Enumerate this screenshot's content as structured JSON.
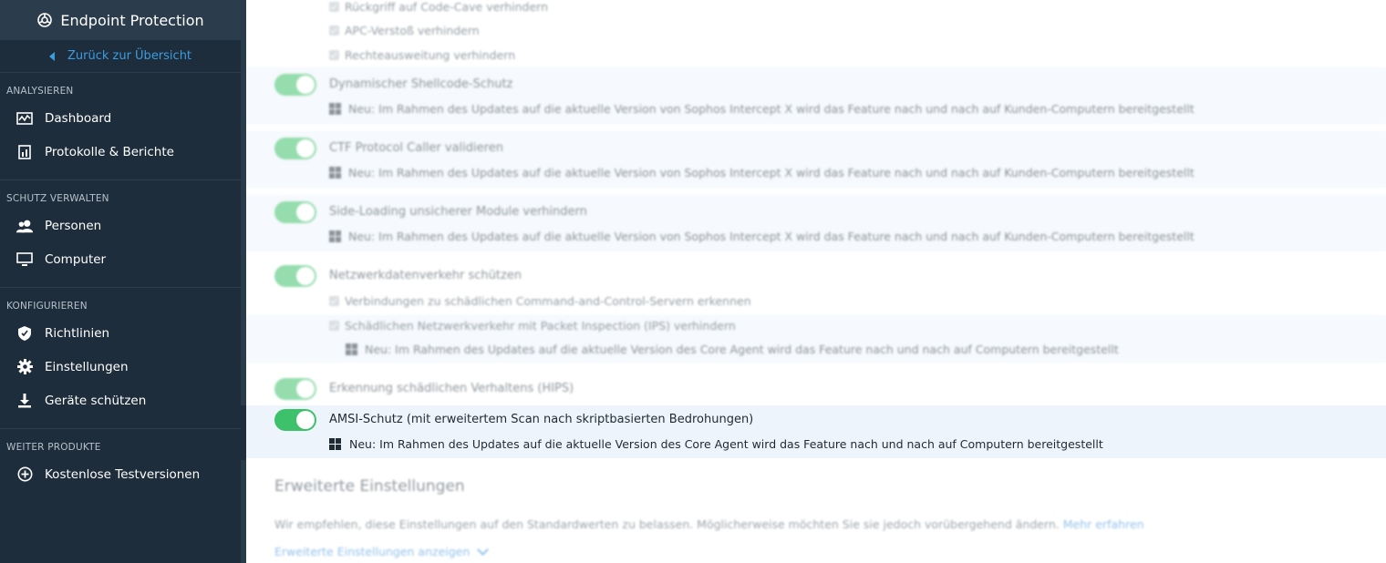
{
  "sidebar": {
    "product_name": "Endpoint Protection",
    "back_label": "Zurück zur Übersicht",
    "sections": [
      {
        "title": "ANALYSIEREN",
        "items": [
          {
            "label": "Dashboard",
            "icon": "dashboard-icon"
          },
          {
            "label": "Protokolle & Berichte",
            "icon": "reports-icon"
          }
        ]
      },
      {
        "title": "SCHUTZ VERWALTEN",
        "items": [
          {
            "label": "Personen",
            "icon": "people-icon"
          },
          {
            "label": "Computer",
            "icon": "monitor-icon"
          }
        ]
      },
      {
        "title": "KONFIGURIEREN",
        "items": [
          {
            "label": "Richtlinien",
            "icon": "shield-icon"
          },
          {
            "label": "Einstellungen",
            "icon": "gear-icon"
          },
          {
            "label": "Geräte schützen",
            "icon": "download-icon"
          }
        ]
      },
      {
        "title": "WEITER PRODUKTE",
        "items": [
          {
            "label": "Kostenlose Testversionen",
            "icon": "plus-circle-icon"
          }
        ]
      }
    ]
  },
  "main": {
    "top_checkboxes": [
      "Rückgriff auf Code-Cave verhindern",
      "APC-Verstoß verhindern",
      "Rechteausweitung verhindern"
    ],
    "features": [
      {
        "title": "Dynamischer Shellcode-Schutz",
        "note": "Neu: Im Rahmen des Updates auf die aktuelle Version von Sophos Intercept X wird das Feature nach und nach auf Kunden-Computern bereitgestellt"
      },
      {
        "title": "CTF Protocol Caller validieren",
        "note": "Neu: Im Rahmen des Updates auf die aktuelle Version von Sophos Intercept X wird das Feature nach und nach auf Kunden-Computern bereitgestellt"
      },
      {
        "title": "Side-Loading unsicherer Module verhindern",
        "note": "Neu: Im Rahmen des Updates auf die aktuelle Version von Sophos Intercept X wird das Feature nach und nach auf Kunden-Computern bereitgestellt"
      },
      {
        "title": "Netzwerkdatenverkehr schützen",
        "checkboxes": [
          "Verbindungen zu schädlichen Command-and-Control-Servern erkennen",
          "Schädlichen Netzwerkverkehr mit Packet Inspection (IPS) verhindern"
        ],
        "note": "Neu: Im Rahmen des Updates auf die aktuelle Version des Core Agent wird das Feature nach und nach auf Computern bereitgestellt"
      },
      {
        "title": "Erkennung schädlichen Verhaltens (HIPS)"
      }
    ],
    "active_feature": {
      "title": "AMSI-Schutz (mit erweitertem Scan nach skriptbasierten Bedrohungen)",
      "note": "Neu: Im Rahmen des Updates auf die aktuelle Version des Core Agent wird das Feature nach und nach auf Computern bereitgestellt",
      "enabled": true
    },
    "advanced": {
      "heading": "Erweiterte Einstellungen",
      "text": "Wir empfehlen, diese Einstellungen auf den Standardwerten zu belassen. Möglicherweise möchten Sie sie jedoch vorübergehend ändern.",
      "link": "Mehr erfahren",
      "show_label": "Erweiterte Einstellungen anzeigen"
    }
  },
  "colors": {
    "sidebar_bg": "#1e2d3b",
    "accent_link": "#3b9de0",
    "toggle_on": "#3ec16b",
    "row_highlight": "#eef4fb"
  }
}
